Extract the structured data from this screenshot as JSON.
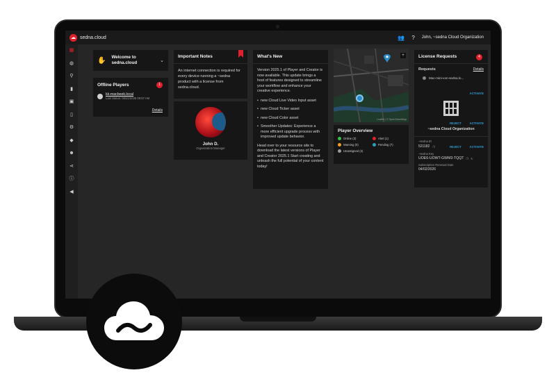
{
  "app": {
    "title": "sedna.cloud",
    "user": "John, ~sedna Cloud Organization"
  },
  "welcome": {
    "text": "Welcome to sedna.cloud"
  },
  "offline": {
    "title": "Offline Players",
    "count": "1",
    "player_name": "kk-macbeek.local",
    "last_status": "Last Status: 05/21/2025 09:57 AM",
    "details": "Details"
  },
  "notes": {
    "title": "Important Notes",
    "body": "An internet connection is required for every device running a ~sedna product with a license from sedna.cloud."
  },
  "profile": {
    "name": "John D.",
    "role": "Organization Manager"
  },
  "news": {
    "title": "What's New",
    "intro": "Version 2025.1 of Player and Creator is now available. This update brings a host of features designed to streamline your workflow and enhance your creative experience.",
    "items": [
      "new Cloud Live Video Input asset",
      "new Cloud Ticker asset",
      "new Cloud Color asset",
      "Smoother Updates: Experience a more efficient upgrade process with improved update behavior."
    ],
    "outro": "Head over to your resource site to download the latest versions of Player and Creator 2025.1 Start creating and unleash the full potential of your content today!"
  },
  "map": {
    "attribution": "Leaflet | © OpenStreetMap"
  },
  "overview": {
    "title": "Player Overview",
    "items": [
      {
        "label": "Online (3)",
        "color": "#35c24a"
      },
      {
        "label": "Alert (1)",
        "color": "#e0202b"
      },
      {
        "label": "Warning (0)",
        "color": "#f0a020"
      },
      {
        "label": "Pending (7)",
        "color": "#2e9db8"
      },
      {
        "label": "Unassigned (2)",
        "color": "#9a9a9a"
      }
    ]
  },
  "license": {
    "title": "License Requests",
    "count": "4",
    "requests_label": "Requests",
    "details": "Details",
    "device": "Mac-mini-von-sedna.lo...",
    "activate": "ACTIVATE",
    "reject": "REJECT",
    "org": "~sedna Cloud Organization",
    "id_label": "~sedna ID",
    "id_value": "521182",
    "key_label": "~sedna Key",
    "key_value": "UOE6-UOWT-GWM3-TQQT",
    "renewal_label": "Subscription Renewal Date",
    "renewal_value": "04/02/2026"
  },
  "icons": {
    "brand": "cloud-icon",
    "accent": "#e0202b",
    "link": "#2e9dd8"
  }
}
